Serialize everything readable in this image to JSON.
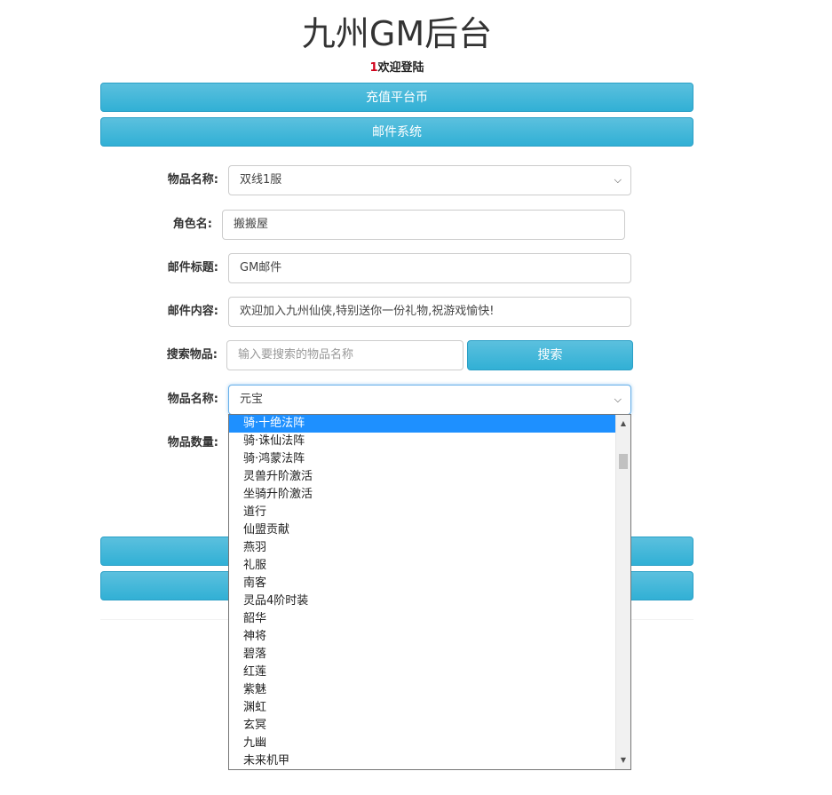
{
  "header": {
    "title": "九州GM后台",
    "welcome_uid": "1",
    "welcome_text": "欢迎登陆"
  },
  "nav": {
    "recharge_label": "充值平台币",
    "mail_label": "邮件系统"
  },
  "form": {
    "server_label": "物品名称:",
    "server_value": "双线1服",
    "role_label": "角色名:",
    "role_value": "搬搬屋",
    "mail_title_label": "邮件标题:",
    "mail_title_value": "GM邮件",
    "mail_content_label": "邮件内容:",
    "mail_content_value": "欢迎加入九州仙侠,特别送你一份礼物,祝游戏愉快!",
    "search_label": "搜索物品:",
    "search_placeholder": "输入要搜索的物品名称",
    "search_button": "搜索",
    "item_label": "物品名称:",
    "item_value": "元宝",
    "quantity_label": "物品数量:"
  },
  "dropdown": {
    "options": [
      "骑·十绝法阵",
      "骑·诛仙法阵",
      "骑·鸿蒙法阵",
      "灵兽升阶激活",
      "坐骑升阶激活",
      "道行",
      "仙盟贡献",
      "燕羽",
      "礼服",
      "南客",
      "灵品4阶时装",
      "韶华",
      "神将",
      "碧落",
      "红莲",
      "紫魅",
      "渊虹",
      "玄冥",
      "九幽",
      "未来机甲"
    ],
    "highlighted_index": 0
  },
  "colors": {
    "button_top": "#5bc0de",
    "button_bottom": "#31b0d5",
    "highlight": "#1e90ff",
    "uid_red": "#d0021b"
  }
}
